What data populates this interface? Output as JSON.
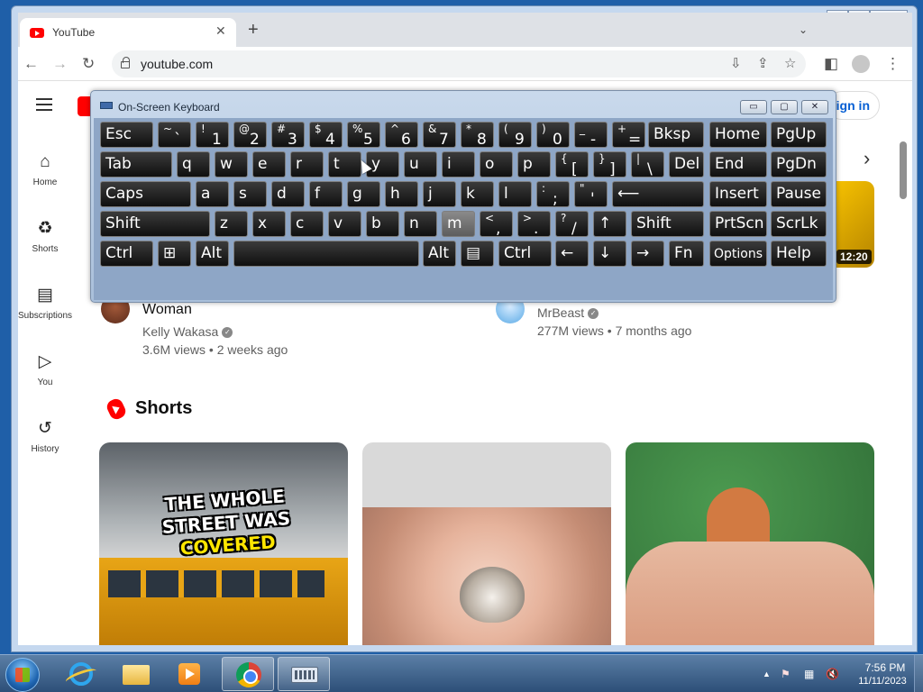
{
  "window_controls": {
    "minimize": "▭",
    "maximize": "▢",
    "close": "✕"
  },
  "browser": {
    "tab_title": "YouTube",
    "tab_close": "✕",
    "new_tab": "+",
    "tab_menu": "⌄",
    "url": "youtube.com",
    "back": "←",
    "forward": "→",
    "reload": "↻",
    "install": "⇩",
    "share": "⇪",
    "star": "☆",
    "panel": "◧",
    "menu": "⋮"
  },
  "youtube": {
    "sign_in": "ign in",
    "sidebar": [
      {
        "label": "Home",
        "icon": "⌂"
      },
      {
        "label": "Shorts",
        "icon": "♻"
      },
      {
        "label": "Subscriptions",
        "icon": "▤"
      },
      {
        "label": "You",
        "icon": "▷"
      },
      {
        "label": "History",
        "icon": "↺"
      }
    ],
    "chevron": "›",
    "videos": [
      {
        "title": "Woman",
        "channel": "Kelly Wakasa",
        "meta": "3.6M views • 2 weeks ago"
      },
      {
        "title": "",
        "channel": "MrBeast",
        "meta": "277M views • 7 months ago"
      }
    ],
    "duration": "12:20",
    "verified": "✓",
    "shorts_title": "Shorts",
    "short1_caption": {
      "l1": "THE WHOLE",
      "l2": "STREET WAS",
      "l3": "COVERED"
    }
  },
  "osk": {
    "title": "On-Screen Keyboard",
    "rows": [
      [
        {
          "m": "Esc"
        },
        {
          "u": "~",
          "l": "`"
        },
        {
          "u": "!",
          "l": "1"
        },
        {
          "u": "@",
          "l": "2"
        },
        {
          "u": "#",
          "l": "3"
        },
        {
          "u": "$",
          "l": "4"
        },
        {
          "u": "%",
          "l": "5"
        },
        {
          "u": "^",
          "l": "6"
        },
        {
          "u": "&",
          "l": "7"
        },
        {
          "u": "*",
          "l": "8"
        },
        {
          "u": "(",
          "l": "9"
        },
        {
          "u": ")",
          "l": "0"
        },
        {
          "u": "_",
          "l": "-"
        },
        {
          "u": "+",
          "l": "="
        },
        {
          "m": "Bksp"
        },
        {
          "m": "Home"
        },
        {
          "m": "PgUp"
        }
      ],
      [
        {
          "m": "Tab"
        },
        {
          "m": "q"
        },
        {
          "m": "w"
        },
        {
          "m": "e"
        },
        {
          "m": "r"
        },
        {
          "m": "t"
        },
        {
          "m": "y"
        },
        {
          "m": "u"
        },
        {
          "m": "i"
        },
        {
          "m": "o"
        },
        {
          "m": "p"
        },
        {
          "u": "{",
          "l": "["
        },
        {
          "u": "}",
          "l": "]"
        },
        {
          "u": "|",
          "l": "\\"
        },
        {
          "m": "Del"
        },
        {
          "m": "End"
        },
        {
          "m": "PgDn"
        }
      ],
      [
        {
          "m": "Caps"
        },
        {
          "m": "a"
        },
        {
          "m": "s"
        },
        {
          "m": "d"
        },
        {
          "m": "f"
        },
        {
          "m": "g"
        },
        {
          "m": "h"
        },
        {
          "m": "j"
        },
        {
          "m": "k"
        },
        {
          "m": "l"
        },
        {
          "u": ":",
          "l": ";"
        },
        {
          "u": "\"",
          "l": "'"
        },
        {
          "m": "⟵"
        },
        {
          "m": "Insert"
        },
        {
          "m": "Pause"
        }
      ],
      [
        {
          "m": "Shift"
        },
        {
          "m": "z"
        },
        {
          "m": "x"
        },
        {
          "m": "c"
        },
        {
          "m": "v"
        },
        {
          "m": "b"
        },
        {
          "m": "n"
        },
        {
          "m": "m"
        },
        {
          "u": "<",
          "l": ","
        },
        {
          "u": ">",
          "l": "."
        },
        {
          "u": "?",
          "l": "/"
        },
        {
          "m": "↑"
        },
        {
          "m": "Shift"
        },
        {
          "m": "PrtScn"
        },
        {
          "m": "ScrLk"
        }
      ],
      [
        {
          "m": "Ctrl"
        },
        {
          "m": "⊞"
        },
        {
          "m": "Alt"
        },
        {
          "m": ""
        },
        {
          "m": "Alt"
        },
        {
          "m": "▤"
        },
        {
          "m": "Ctrl"
        },
        {
          "m": "←"
        },
        {
          "m": "↓"
        },
        {
          "m": "→"
        },
        {
          "m": "Fn"
        },
        {
          "m": "Options"
        },
        {
          "m": "Help"
        }
      ]
    ],
    "pressed_key": "m"
  },
  "taskbar": {
    "time": "7:56 PM",
    "date": "11/11/2023",
    "tray_up": "▲",
    "tray_flag": "⚑",
    "tray_network": "▦",
    "tray_volume": "🔇"
  }
}
